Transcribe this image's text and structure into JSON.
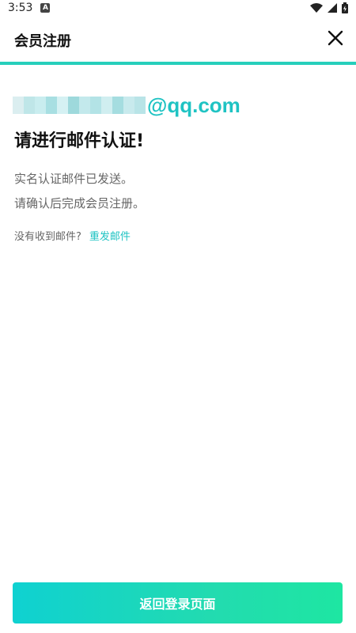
{
  "status_bar": {
    "time": "3:53",
    "notification_icon": "a-box-icon",
    "icons": [
      "wifi-icon",
      "signal-icon",
      "battery-icon"
    ]
  },
  "header": {
    "title": "会员注册",
    "close_icon": "close-icon"
  },
  "email": {
    "domain": "@qq.com",
    "local_part_masked": true
  },
  "heading": "请进行邮件认证!",
  "messages": [
    "实名认证邮件已发送。",
    "请确认后完成会员注册。"
  ],
  "resend": {
    "prompt": "没有收到邮件?",
    "link_label": "重发邮件"
  },
  "bottom_button": {
    "label": "返回登录页面"
  },
  "colors": {
    "accent": "#1fc3c3",
    "header_rule": "#26cfbb",
    "button_gradient_start": "#0fd1d1",
    "button_gradient_end": "#1ee6a2"
  }
}
